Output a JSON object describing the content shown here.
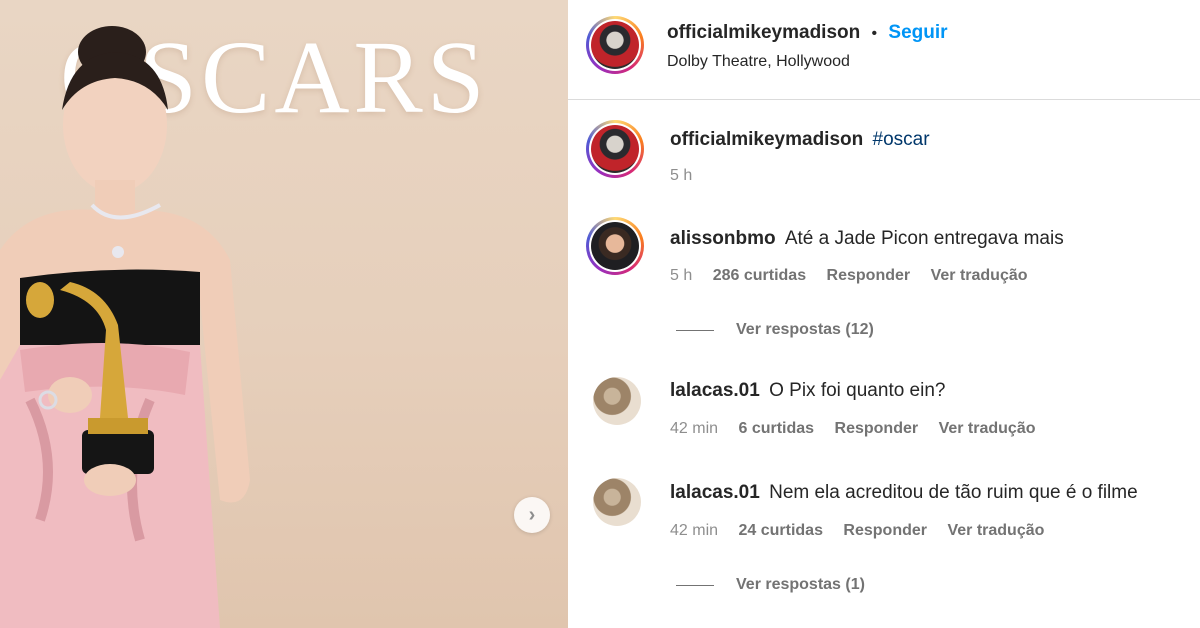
{
  "photo": {
    "backdrop_text": "OSCARS",
    "next_icon": "chevron-right-icon"
  },
  "header": {
    "username": "officialmikeymadison",
    "separator": "•",
    "follow_label": "Seguir",
    "location": "Dolby Theatre, Hollywood"
  },
  "caption": {
    "username": "officialmikeymadison",
    "hashtag": "#oscar",
    "time": "5 h"
  },
  "comments": [
    {
      "username": "alissonbmo",
      "text": "Até a Jade Picon entregava mais",
      "time": "5 h",
      "likes": "286 curtidas",
      "reply": "Responder",
      "translate": "Ver tradução",
      "view_replies": "Ver respostas (12)"
    },
    {
      "username": "lalacas.01",
      "text": "O Pix foi quanto ein?",
      "time": "42 min",
      "likes": "6 curtidas",
      "reply": "Responder",
      "translate": "Ver tradução"
    },
    {
      "username": "lalacas.01",
      "text": "Nem ela acreditou de tão ruim que é o filme",
      "time": "42 min",
      "likes": "24 curtidas",
      "reply": "Responder",
      "translate": "Ver tradução",
      "view_replies": "Ver respostas (1)"
    }
  ],
  "colors": {
    "link_blue": "#0095f6",
    "hashtag_blue": "#00376b",
    "secondary_text": "#8e8e8e"
  }
}
